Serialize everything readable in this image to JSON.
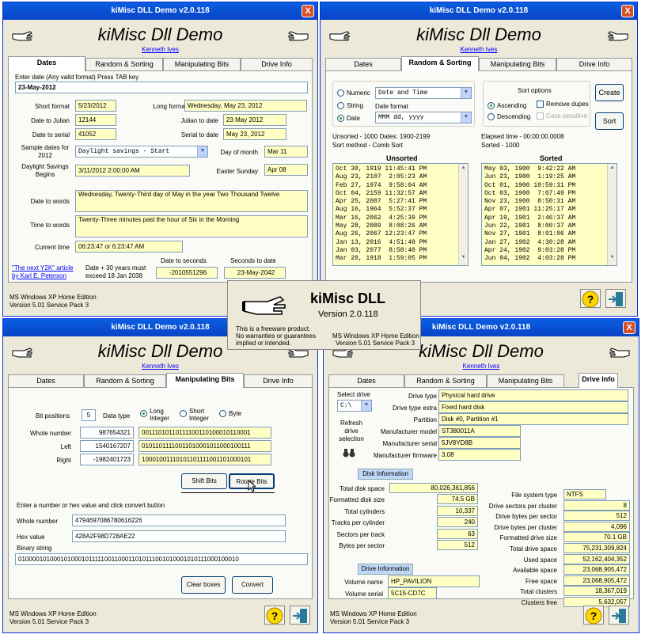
{
  "window_title": "kiMisc DLL Demo v2.0.118",
  "close_glyph": "X",
  "header": "kiMisc Dll Demo",
  "author": "Kenneth Ives",
  "tabs": [
    "Dates",
    "Random & Sorting",
    "Manipulating Bits",
    "Drive Info"
  ],
  "status": {
    "os": "MS Windows XP Home Edition",
    "version": "Version 5.01    Service Pack 3"
  },
  "dates": {
    "enter_label": "Enter date  (Any valid format)   Press TAB key",
    "enter_value": "23-May-2012",
    "short_format_label": "Short format",
    "short_format": "5/23/2012",
    "long_format_label": "Long format",
    "long_format": "Wednesday, May 23, 2012",
    "date_to_julian_label": "Date to Julian",
    "date_to_julian": "12144",
    "julian_to_date_label": "Julian to date",
    "julian_to_date": "23 May 2012",
    "date_to_serial_label": "Date to serial",
    "date_to_serial": "41052",
    "serial_to_date_label": "Serial to date",
    "serial_to_date": "May 23, 2012",
    "sample_label": "Sample dates for 2012",
    "sample_value": "Daylight savings - Start",
    "day_of_month_label": "Day of month",
    "day_of_month": "Mar 11",
    "dst_label": "Daylight Savings Begins",
    "dst_value": "3/11/2012 2:00:00 AM",
    "easter_label": "Easter Sunday",
    "easter": "Apr 08",
    "date_to_words_label": "Date to words",
    "date_to_words": "Wednesday, Twenty-Third day of May in the year Two Thousand Twelve",
    "time_to_words_label": "Time to words",
    "time_to_words": "Twenty-Three minutes past the hour of Six in the Morning",
    "current_time_label": "Current time",
    "current_time": "06:23:47  or  6:23:47 AM",
    "y2k_link_1": "\"The next Y2K\" article",
    "y2k_link_2": "by Karl E. Peterson",
    "warn_1": "Date + 30 years must",
    "warn_2": "exceed 18 Jan 2038",
    "date_to_seconds_label": "Date to seconds",
    "date_to_seconds": "-2010551296",
    "seconds_to_date_label": "Seconds to date",
    "seconds_to_date": "23-May-2042"
  },
  "random": {
    "opt_numeric": "Numeric",
    "opt_string": "String",
    "opt_date": "Date",
    "selected_type": "Date",
    "type_combo": "Date and Time",
    "date_format_label": "Date format",
    "date_format_combo": "MMM dd, yyyy",
    "sort_options_label": "Sort options",
    "opt_ascending": "Ascending",
    "opt_descending": "Descending",
    "remove_dupes": "Remove dupes",
    "case_sensitive": "Case sensitive",
    "create_btn": "Create",
    "sort_btn": "Sort",
    "info_1": "Unsorted - 1000    Dates: 1900-2199",
    "info_2": "Sort method - Comb Sort",
    "info_3": "Elapsed time - 00:00:00.0008",
    "info_4": "Sorted - 1000",
    "unsorted_label": "Unsorted",
    "sorted_label": "Sorted",
    "unsorted": [
      "Oct 30, 1919 11:45:41 PM",
      "Aug 23, 2107  2:05:23 AM",
      "Feb 27, 1974  9:58:04 AM",
      "Oct 04, 2159 11:32:57 AM",
      "Apr 25, 2007  5:27:41 PM",
      "Aug 16, 1964  5:52:37 PM",
      "Mar 16, 2062  4:25:39 PM",
      "May 28, 2009  8:08:26 AM",
      "Aug 26, 2067 12:23:47 PM",
      "Jan 13, 2016  4:51:48 PM",
      "Jan 03, 2077  8:58:40 PM",
      "Mar 20, 1918  1:59:05 PM"
    ],
    "sorted": [
      "May 03, 1900  9:42:22 AM",
      "Jun 23, 1900  1:19:25 AM",
      "Oct 01, 1900 10:59:31 PM",
      "Oct 03, 1900  7:07:49 PM",
      "Nov 23, 1900  8:50:31 AM",
      "Apr 07, 1901 11:25:17 AM",
      "Apr 19, 1901  2:46:37 AM",
      "Jun 22, 1901  8:00:37 AM",
      "Nov 27, 1901  8:01:06 AM",
      "Jan 27, 1902  4:30:28 AM",
      "Apr 24, 1902  9:03:28 PM",
      "Jun 04, 1902  4:03:28 PM"
    ]
  },
  "splash": {
    "title": "kiMisc DLL",
    "version": "Version 2.0.118",
    "l1": "This is a freeware product.",
    "l2": "No warranties or guarantees",
    "l3": "implied or intended.",
    "os": "MS Windows XP Home Edition",
    "sp": "Version 5.01   Service Pack 3"
  },
  "bits": {
    "positions_label": "Bit positions",
    "positions": "5",
    "data_type_label": "Data type",
    "opt_long": "Long Integer",
    "opt_short": "Short Integer",
    "opt_byte": "Byte",
    "selected_type": "Long Integer",
    "whole_label": "Whole number",
    "whole": "987654321",
    "whole_bin": "00111010110111100110100010110001",
    "left_label": "Left",
    "left": "1540167207",
    "left_bin": "01011011110011010001011000100111",
    "right_label": "Right",
    "right": "-1982401723",
    "right_bin": "10001001110101101111001101000101",
    "shift_btn": "Shift Bits",
    "rotate_btn": "Rotate Bits",
    "convert_prompt": "Enter a number or hex value and click convert button",
    "whole2_label": "Whole number",
    "whole2": "4794697086780616226",
    "hex_label": "Hex value",
    "hex": "428A2F98D728AE22",
    "binary_label": "Binary string",
    "binary": "0100001010001010001011111001100011010111001010001010111000100010",
    "clear_btn": "Clear boxes",
    "convert_btn": "Convert"
  },
  "drive": {
    "select_label": "Select drive",
    "select_value": "C:\\",
    "refresh_label": "Refresh drive selection",
    "drive_type_label": "Drive type",
    "drive_type": "Physical hard drive",
    "drive_type_extra_label": "Drive type extra",
    "drive_type_extra": "Fixed hard disk",
    "partition_label": "Partition",
    "partition": "Disk #0, Partition #1",
    "model_label": "Manufacturer model",
    "model": "ST380011A",
    "serial_label": "Manufacturer serial",
    "serial": "5JV8YD8B",
    "firmware_label": "Manufacturer firmware",
    "firmware": "3.08",
    "disk_info_label": "Disk Information",
    "disk": [
      [
        "Total disk space",
        "80,026,361,856"
      ],
      [
        "Formatted disk size",
        "74.5 GB"
      ],
      [
        "Total cylinders",
        "10,337"
      ],
      [
        "Tracks per cylinder",
        "240"
      ],
      [
        "Sectors per track",
        "63"
      ],
      [
        "Bytes per sector",
        "512"
      ]
    ],
    "fs": [
      [
        "File system type",
        "NTFS"
      ],
      [
        "Drive sectors per cluster",
        "8"
      ],
      [
        "Drive bytes per sector",
        "512"
      ],
      [
        "Drive bytes per cluster",
        "4,096"
      ],
      [
        "Formatted drive size",
        "70.1 GB"
      ],
      [
        "Total drive space",
        "75,231,309,824"
      ],
      [
        "Used space",
        "52,162,404,352"
      ],
      [
        "Available space",
        "23,068,905,472"
      ],
      [
        "Free space",
        "23,068,905,472"
      ],
      [
        "Total clusters",
        "18,367,019"
      ],
      [
        "Clusters free",
        "5,632,057"
      ]
    ],
    "drive_info_label": "Drive Information",
    "volume_name_label": "Volume name",
    "volume_name": "HP_PAVILION",
    "volume_serial_label": "Volume serial",
    "volume_serial": "5C15-CD7C"
  }
}
